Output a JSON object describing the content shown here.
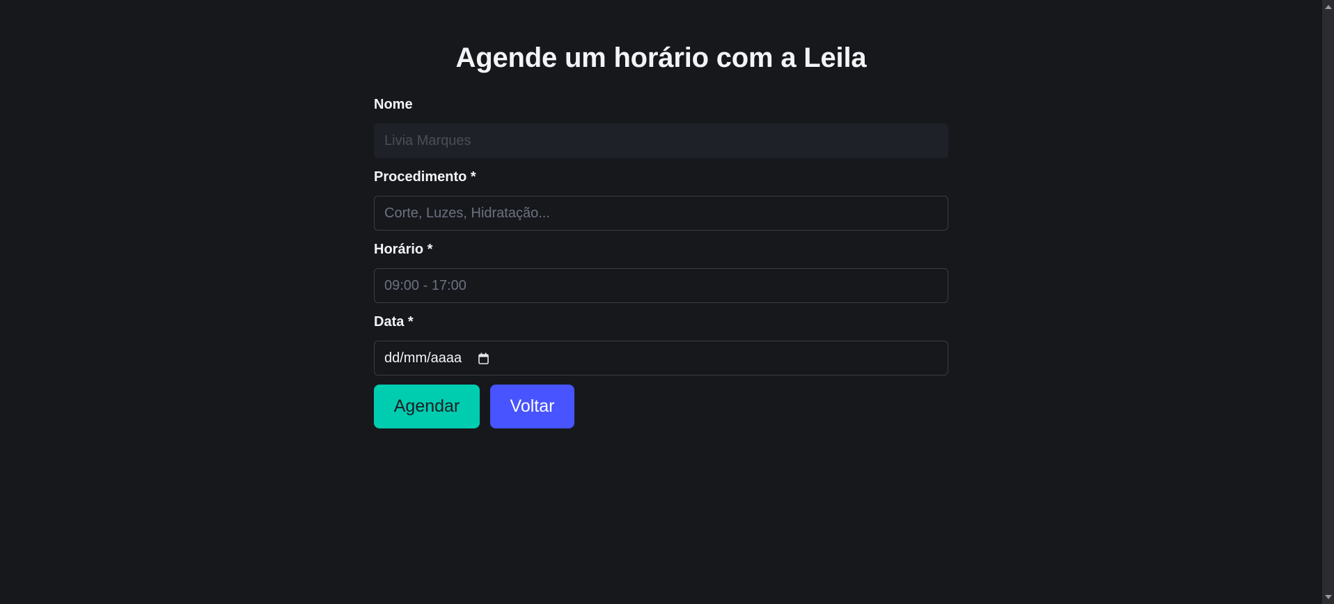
{
  "page": {
    "title": "Agende um horário com a Leila"
  },
  "form": {
    "name": {
      "label": "Nome",
      "value": "Livia Marques"
    },
    "procedure": {
      "label": "Procedimento *",
      "placeholder": "Corte, Luzes, Hidratação..."
    },
    "time": {
      "label": "Horário *",
      "placeholder": "09:00 - 17:00"
    },
    "date": {
      "label": "Data *",
      "placeholder": "dd/mm/aaaa",
      "icon": "calendar-icon"
    }
  },
  "actions": {
    "schedule_label": "Agendar",
    "back_label": "Voltar"
  },
  "colors": {
    "background": "#17181c",
    "primary": "#00ccb0",
    "secondary": "#4754ff"
  }
}
